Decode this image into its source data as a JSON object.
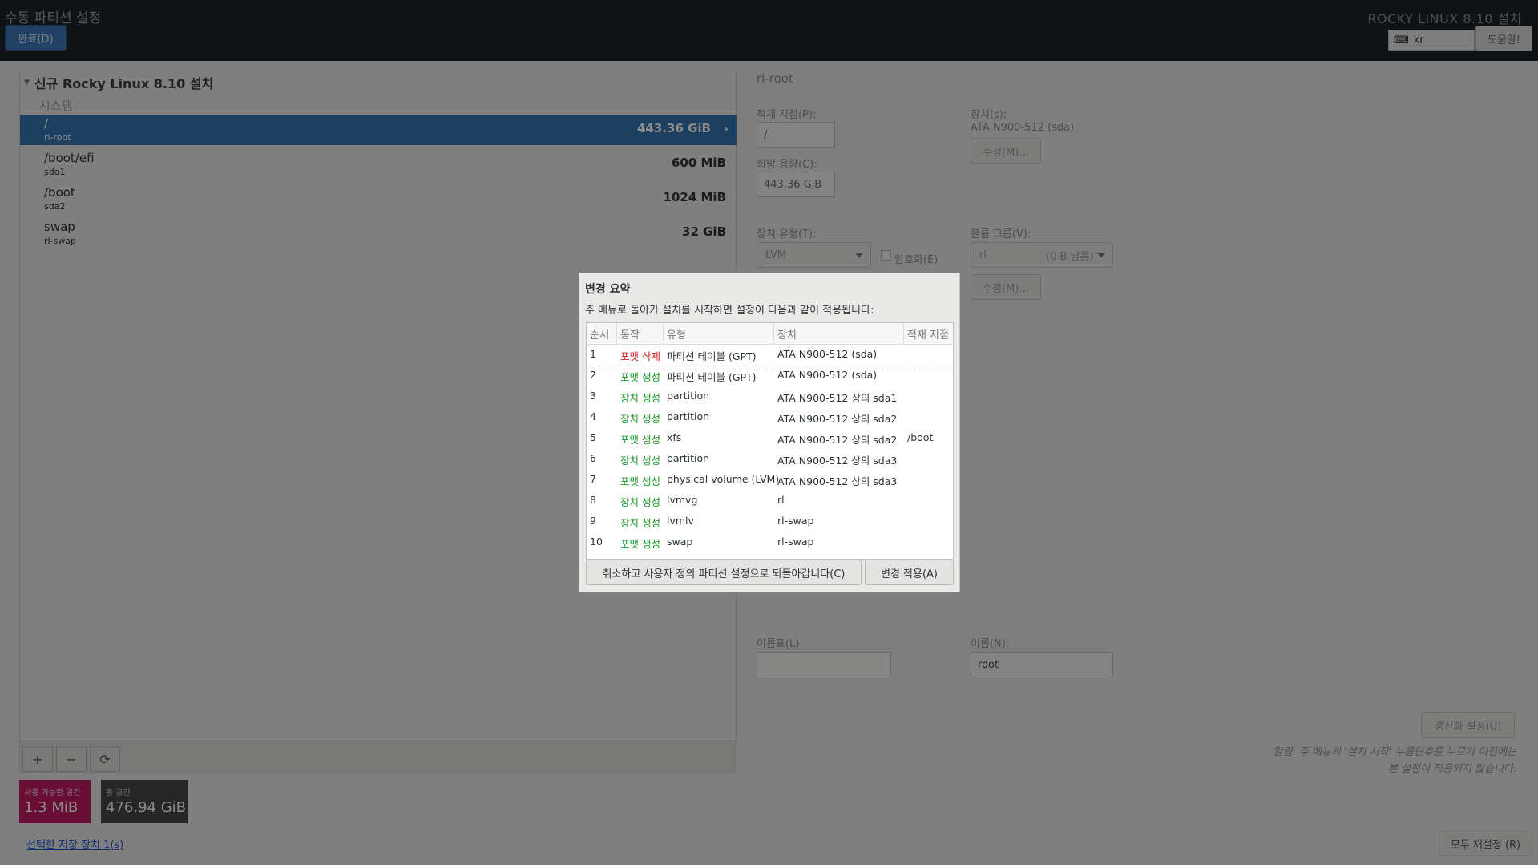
{
  "header": {
    "title": "수동 파티션 설정",
    "done_label": "완료(D)",
    "product": "ROCKY LINUX 8.10 설치",
    "keyboard": "kr",
    "help_label": "도움말!"
  },
  "left": {
    "install_title": "신규 Rocky Linux 8.10 설치",
    "system_label": "시스템",
    "mounts": [
      {
        "mount": "/",
        "device": "rl-root",
        "size": "443.36 GiB"
      },
      {
        "mount": "/boot/efi",
        "device": "sda1",
        "size": "600 MiB"
      },
      {
        "mount": "/boot",
        "device": "sda2",
        "size": "1024 MiB"
      },
      {
        "mount": "swap",
        "device": "rl-swap",
        "size": "32 GiB"
      }
    ],
    "toolbar": {
      "add": "+",
      "remove": "−",
      "refresh": "⟳"
    },
    "available_label": "사용 가능한 공간",
    "available_value": "1.3 MiB",
    "total_label": "총 공간",
    "total_value": "476.94 GiB",
    "storage_link": "선택한 저장 장치 1(s)"
  },
  "right": {
    "title": "rl-root",
    "mount_label": "적재 지점(P):",
    "mount_value": "/",
    "capacity_label": "희망 용량(C):",
    "capacity_value": "443.36 GiB",
    "devices_label": "장치(s):",
    "devices_value": "ATA N900-512 (sda)",
    "modify_label": "수정(M)...",
    "device_type_label": "장치 유형(T):",
    "device_type_value": "LVM",
    "encrypt_label": "암호화(E)",
    "volume_group_label": "볼륨 그룹(V):",
    "volume_group_value": "rl",
    "volume_group_free": "(0 B 남음)",
    "modify2_label": "수정(M)...",
    "label_label": "이름표(L):",
    "label_value": "",
    "name_label": "이름(N):",
    "name_value": "root",
    "update_label": "갱신화 설정(U)",
    "note_line1": "알림: 주 메뉴의 '설치 시작' 누름단추를 누르기 이전에는",
    "note_line2": "본 설정이 적용되지 않습니다.",
    "reset_label": "모두 재설정 (R)"
  },
  "dialog": {
    "title": "변경 요약",
    "description": "주 메뉴로 돌아가 설치를 시작하면 설정이 다음과 같이 적용됩니다:",
    "columns": [
      "순서",
      "동작",
      "유형",
      "장치",
      "적재 지점"
    ],
    "rows": [
      {
        "order": "1",
        "action": "포맷 삭제",
        "kind": "del",
        "type": "파티션 테이블 (GPT)",
        "device": "ATA N900-512 (sda)",
        "mount": ""
      },
      {
        "order": "2",
        "action": "포맷 생성",
        "kind": "add",
        "type": "파티션 테이블 (GPT)",
        "device": "ATA N900-512 (sda)",
        "mount": ""
      },
      {
        "order": "3",
        "action": "장치 생성",
        "kind": "add",
        "type": "partition",
        "device": "ATA N900-512 상의 sda1",
        "mount": ""
      },
      {
        "order": "4",
        "action": "장치 생성",
        "kind": "add",
        "type": "partition",
        "device": "ATA N900-512 상의 sda2",
        "mount": ""
      },
      {
        "order": "5",
        "action": "포맷 생성",
        "kind": "add",
        "type": "xfs",
        "device": "ATA N900-512 상의 sda2",
        "mount": "/boot"
      },
      {
        "order": "6",
        "action": "장치 생성",
        "kind": "add",
        "type": "partition",
        "device": "ATA N900-512 상의 sda3",
        "mount": ""
      },
      {
        "order": "7",
        "action": "포맷 생성",
        "kind": "add",
        "type": "physical volume (LVM)",
        "device": "ATA N900-512 상의 sda3",
        "mount": ""
      },
      {
        "order": "8",
        "action": "장치 생성",
        "kind": "add",
        "type": "lvmvg",
        "device": "rl",
        "mount": ""
      },
      {
        "order": "9",
        "action": "장치 생성",
        "kind": "add",
        "type": "lvmlv",
        "device": "rl-swap",
        "mount": ""
      },
      {
        "order": "10",
        "action": "포맷 생성",
        "kind": "add",
        "type": "swap",
        "device": "rl-swap",
        "mount": ""
      }
    ],
    "cancel_label": "취소하고 사용자 정의 파티션 설정으로 되돌아갑니다(C)",
    "accept_label": "변경 적용(A)"
  },
  "colors": {
    "header_bg": "#1c2329",
    "selected_row": "#3574b0",
    "available_box": "#c01c63",
    "delete_action": "#d41c1c",
    "create_action": "#1a9b2a"
  }
}
